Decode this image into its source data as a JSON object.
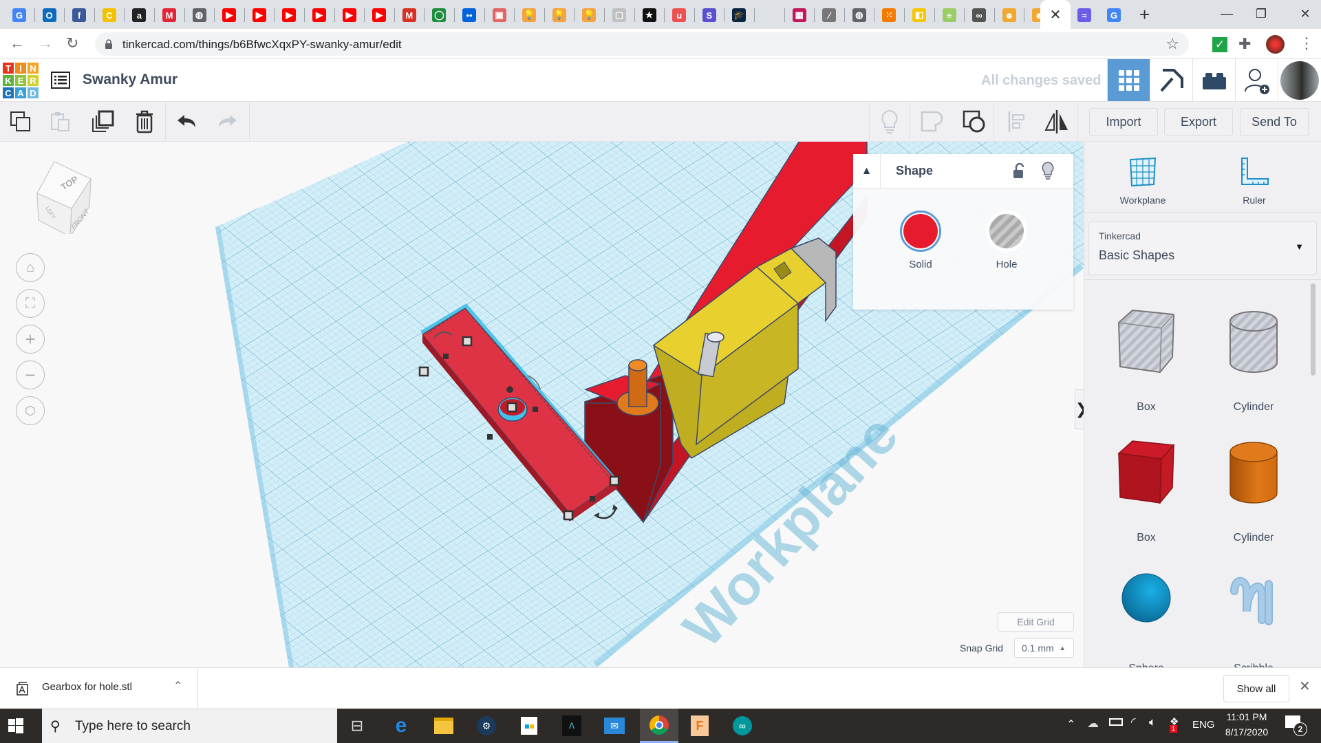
{
  "browser": {
    "url": "tinkercad.com/things/b6BfwcXqxPY-swanky-amur/edit",
    "tabs": [
      {
        "icon": "google-translate-icon",
        "glyph": "G",
        "color": "#4285f4"
      },
      {
        "icon": "outlook-icon",
        "glyph": "O",
        "color": "#0f6cbd"
      },
      {
        "icon": "facebook-icon",
        "glyph": "f",
        "color": "#3b5998"
      },
      {
        "icon": "c-icon",
        "glyph": "C",
        "color": "#f2c200"
      },
      {
        "icon": "amazon-icon",
        "glyph": "a",
        "color": "#222222"
      },
      {
        "icon": "m-icon",
        "glyph": "M",
        "color": "#e32636"
      },
      {
        "icon": "globe-icon",
        "glyph": "◍",
        "color": "#5f6368"
      },
      {
        "icon": "youtube-icon",
        "glyph": "▶",
        "color": "#ff0000"
      },
      {
        "icon": "youtube-icon",
        "glyph": "▶",
        "color": "#ff0000"
      },
      {
        "icon": "youtube-icon",
        "glyph": "▶",
        "color": "#ff0000"
      },
      {
        "icon": "youtube-icon",
        "glyph": "▶",
        "color": "#ff0000"
      },
      {
        "icon": "youtube-icon",
        "glyph": "▶",
        "color": "#ff0000"
      },
      {
        "icon": "youtube-icon",
        "glyph": "▶",
        "color": "#ff0000"
      },
      {
        "icon": "gmail-icon",
        "glyph": "M",
        "color": "#d93025"
      },
      {
        "icon": "green-circle-icon",
        "glyph": "◯",
        "color": "#1e8e3e"
      },
      {
        "icon": "flickr-icon",
        "glyph": "••",
        "color": "#0063dc"
      },
      {
        "icon": "red-app-icon",
        "glyph": "▣",
        "color": "#e06666"
      },
      {
        "icon": "bulb-icon",
        "glyph": "💡",
        "color": "#f4a340"
      },
      {
        "icon": "bulb-icon",
        "glyph": "💡",
        "color": "#f4a340"
      },
      {
        "icon": "bulb-icon",
        "glyph": "💡",
        "color": "#f4a340"
      },
      {
        "icon": "white-app-icon",
        "glyph": "▢",
        "color": "#c0c0c0"
      },
      {
        "icon": "star-icon",
        "glyph": "★",
        "color": "#111111"
      },
      {
        "icon": "udemy-icon",
        "glyph": "u",
        "color": "#ec5252"
      },
      {
        "icon": "s-icon",
        "glyph": "S",
        "color": "#5a4fcf"
      },
      {
        "icon": "graduation-icon",
        "glyph": "🎓",
        "color": "#0a2540"
      },
      {
        "icon": "blank-icon",
        "glyph": "",
        "color": "#dee1e6"
      },
      {
        "icon": "calendar-icon",
        "glyph": "▦",
        "color": "#c2185b"
      },
      {
        "icon": "signature-icon",
        "glyph": "∕",
        "color": "#777777"
      },
      {
        "icon": "globe-icon",
        "glyph": "◍",
        "color": "#5f6368"
      },
      {
        "icon": "dots-grid-icon",
        "glyph": "⁙",
        "color": "#f57c00"
      },
      {
        "icon": "yellow-app-icon",
        "glyph": "◧",
        "color": "#f6c700"
      },
      {
        "icon": "stema-icon",
        "glyph": "≡",
        "color": "#9ccc65"
      },
      {
        "icon": "link-icon",
        "glyph": "∞",
        "color": "#555555"
      },
      {
        "icon": "tinkercad-bot-icon",
        "glyph": "☻",
        "color": "#f0a830"
      },
      {
        "icon": "tinkercad-bot-icon",
        "glyph": "☻",
        "color": "#f0a830"
      }
    ],
    "active_tab_close": "✕",
    "after_tabs": [
      {
        "icon": "purple-app-icon",
        "glyph": "≈",
        "color": "#6c5ce7"
      },
      {
        "icon": "google-icon",
        "glyph": "G",
        "color": "#4285f4"
      }
    ],
    "new_tab": "+",
    "window": {
      "minimize": "—",
      "maximize": "❐",
      "close": "✕"
    }
  },
  "tinkercad": {
    "logo_letters": [
      {
        "l": "T",
        "c": "#e2371d"
      },
      {
        "l": "I",
        "c": "#f08b1d"
      },
      {
        "l": "N",
        "c": "#f2a623"
      },
      {
        "l": "K",
        "c": "#5eb13c"
      },
      {
        "l": "E",
        "c": "#8fc43f"
      },
      {
        "l": "R",
        "c": "#cfd12f"
      },
      {
        "l": "C",
        "c": "#1e72bd"
      },
      {
        "l": "A",
        "c": "#3d9dd6"
      },
      {
        "l": "D",
        "c": "#6fbbe2"
      }
    ],
    "project_title": "Swanky Amur",
    "save_status": "All changes saved",
    "toolbar": {
      "import": "Import",
      "export": "Export",
      "send_to": "Send To"
    },
    "view_cube": {
      "top": "TOP",
      "left": "LEFT",
      "front": "FRONT"
    },
    "shape_panel": {
      "title": "Shape",
      "solid_label": "Solid",
      "hole_label": "Hole",
      "solid_color": "#e61c2e",
      "selected": "Solid"
    },
    "workplane_text": "Workplane",
    "edit_grid": "Edit Grid",
    "snap_grid_label": "Snap Grid",
    "snap_grid_value": "0.1 mm",
    "right_panel": {
      "workplane": "Workplane",
      "ruler": "Ruler",
      "library_source": "Tinkercad",
      "library_name": "Basic Shapes",
      "shapes": [
        {
          "name": "Box",
          "type": "hole-box"
        },
        {
          "name": "Cylinder",
          "type": "hole-cylinder"
        },
        {
          "name": "Box",
          "type": "box"
        },
        {
          "name": "Cylinder",
          "type": "cylinder"
        },
        {
          "name": "Sphere",
          "type": "sphere"
        },
        {
          "name": "Scribble",
          "type": "scribble"
        }
      ]
    }
  },
  "downloads": {
    "file_name": "Gearbox for hole.stl",
    "show_all": "Show all"
  },
  "taskbar": {
    "search_placeholder": "Type here to search",
    "language": "ENG",
    "time": "11:01 PM",
    "date": "8/17/2020",
    "notification_count": "2",
    "dropbox_badge": "1"
  }
}
